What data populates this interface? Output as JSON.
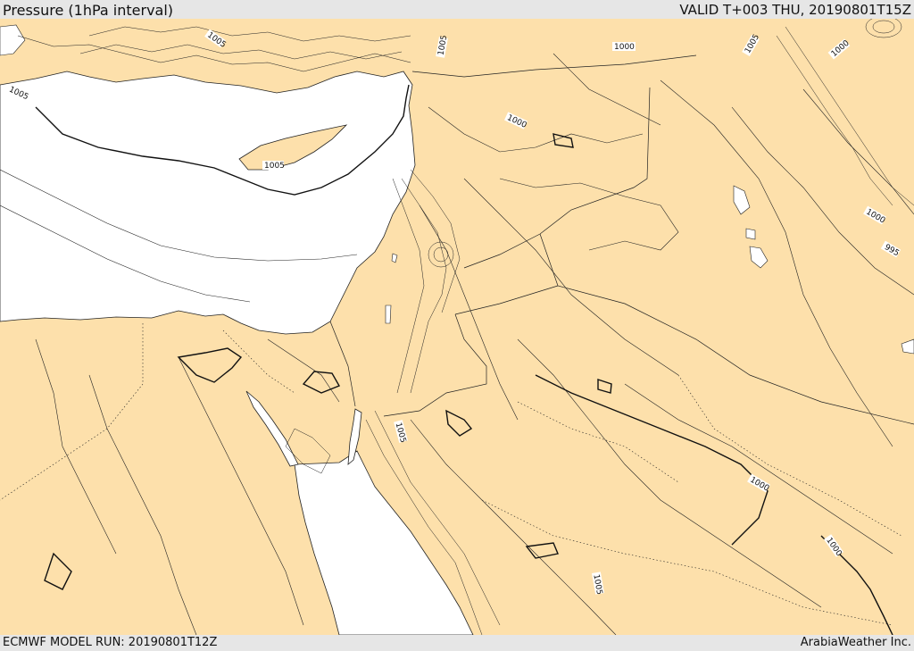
{
  "header": {
    "title": "Pressure (1hPa interval)",
    "valid": "VALID T+003 THU, 20190801T15Z"
  },
  "footer": {
    "model_run": "ECMWF MODEL RUN: 20190801T12Z",
    "credit": "ArabiaWeather Inc."
  },
  "map": {
    "land_color": "#fde0ab",
    "sea_color": "#ffffff",
    "contour_labels": [
      "1005",
      "1005",
      "1005",
      "1005",
      "1005",
      "1000",
      "1000",
      "1000",
      "1000",
      "995",
      "1005",
      "1000",
      "1005",
      "1000"
    ]
  }
}
